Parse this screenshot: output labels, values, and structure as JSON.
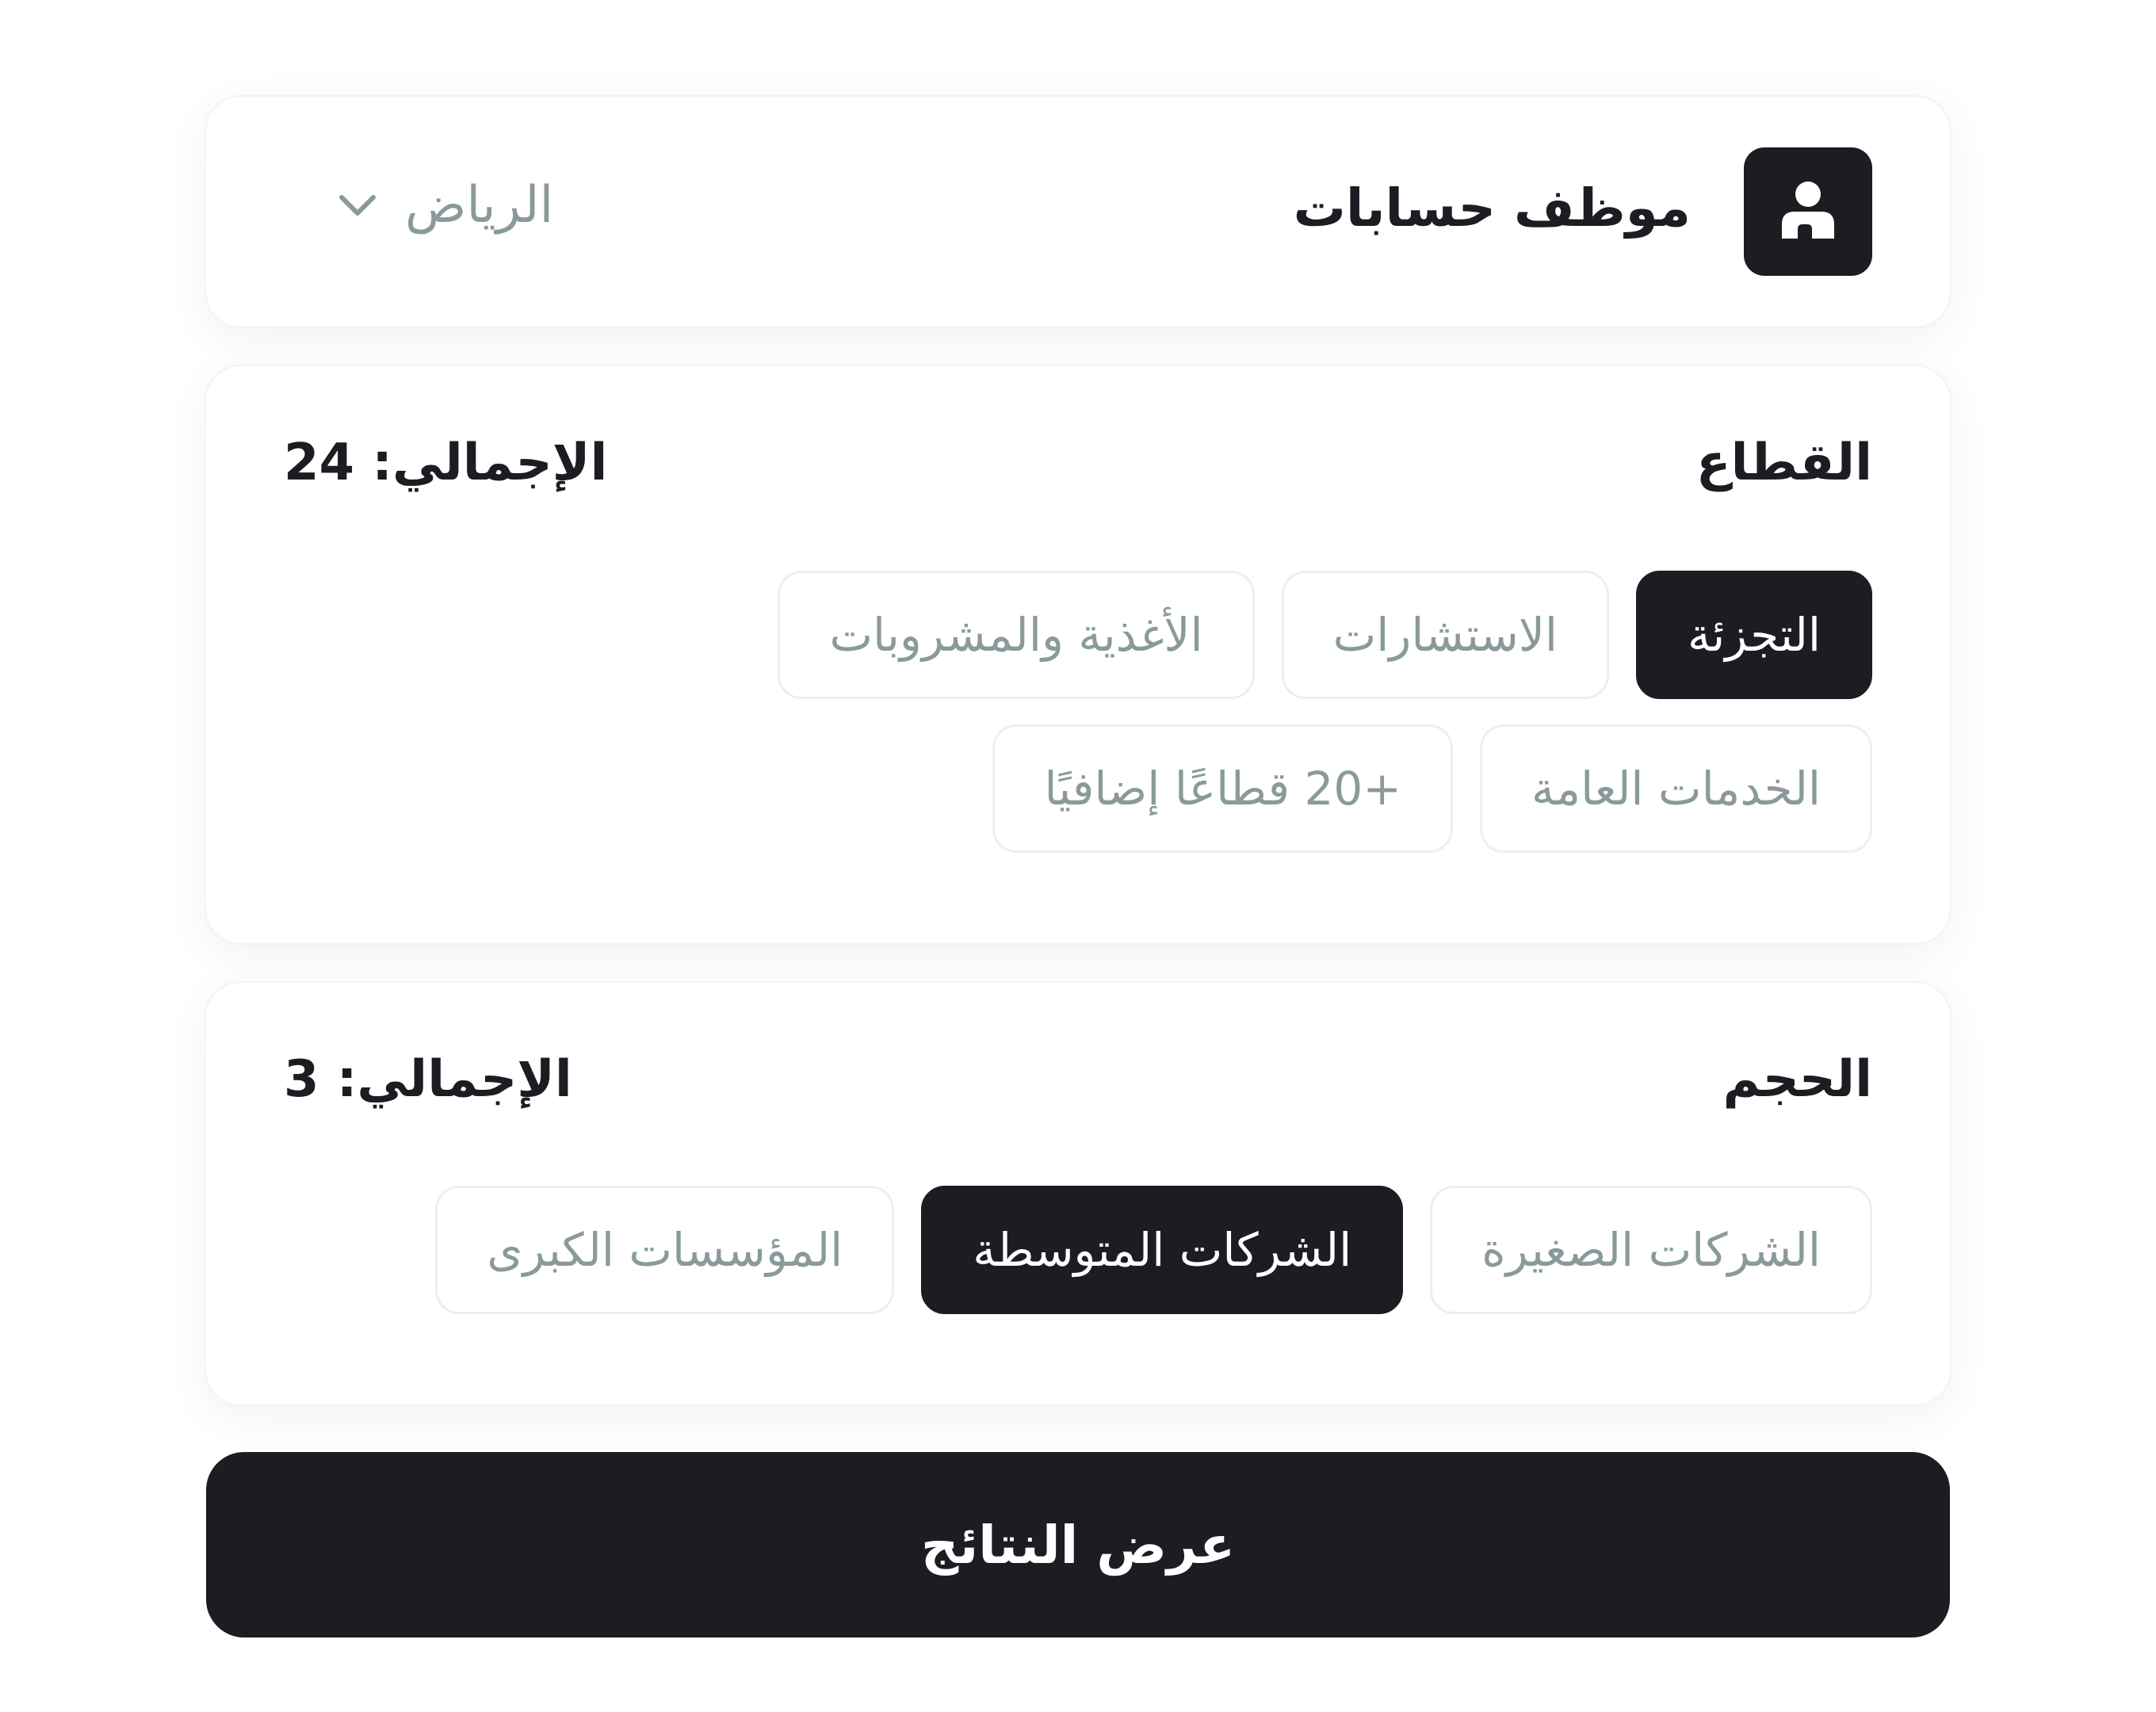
{
  "job": {
    "title": "موظف حسابات",
    "location": "الرياض",
    "avatar_icon": "user-icon",
    "location_icon": "chevron-down-icon"
  },
  "sector": {
    "title": "القطاع",
    "total": "الإجمالي: 24",
    "chips": [
      {
        "label": "التجزئة",
        "selected": true
      },
      {
        "label": "الاستشارات",
        "selected": false
      },
      {
        "label": "الأغذية والمشروبات",
        "selected": false
      },
      {
        "label": "الخدمات العامة",
        "selected": false
      },
      {
        "label": "+20 قطاعًا إضافيًا",
        "selected": false
      }
    ]
  },
  "size": {
    "title": "الحجم",
    "total": "الإجمالي: 3",
    "chips": [
      {
        "label": "الشركات الصغيرة",
        "selected": false
      },
      {
        "label": "الشركات المتوسطة",
        "selected": true
      },
      {
        "label": "المؤسسات الكبرى",
        "selected": false
      }
    ]
  },
  "actions": {
    "show_results": "عرض النتائج"
  },
  "colors": {
    "primary": "#1c1d23",
    "muted_text": "#8a9a9a",
    "chip_border": "#eeeeef",
    "background": "#ffffff"
  }
}
